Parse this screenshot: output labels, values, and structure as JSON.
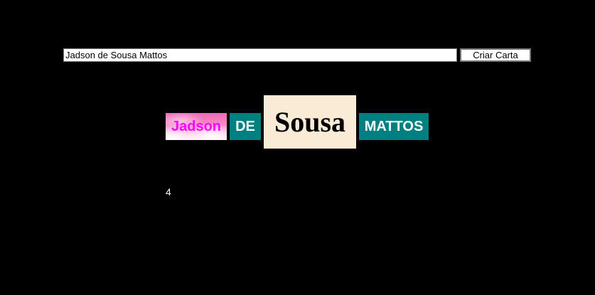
{
  "form": {
    "input_value": "Jadson de Sousa Mattos",
    "button_label": "Criar Carta"
  },
  "carta": {
    "words": [
      "Jadson",
      "DE",
      "Sousa",
      "MATTOS"
    ]
  },
  "contador": {
    "value": "4"
  },
  "colors": {
    "page_background": "#000000",
    "teal": "#008080",
    "magenta": "#ff00ff",
    "antique_white": "#faebd7"
  }
}
